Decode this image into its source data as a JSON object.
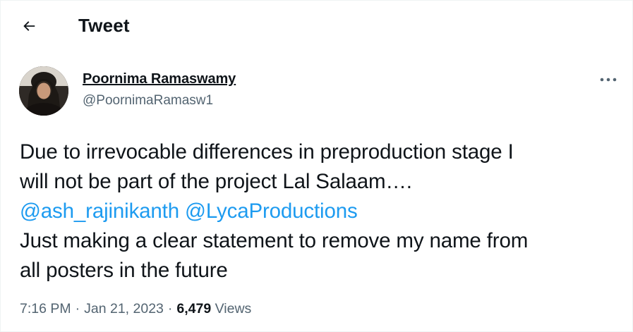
{
  "header": {
    "title": "Tweet",
    "back_icon": "arrow-left-icon"
  },
  "author": {
    "display_name": "Poornima Ramaswamy",
    "handle": "@PoornimaRamasw1",
    "more_icon": "more-horizontal-icon"
  },
  "tweet": {
    "line1": "Due to irrevocable differences in preproduction stage I",
    "line2": "will not be part of the project Lal Salaam….",
    "mention1": "@ash_rajinikanth",
    "mention2": "@LycaProductions",
    "line4": "Just making a clear statement to remove my name from",
    "line5": "all posters in the future"
  },
  "meta": {
    "time": "7:16 PM",
    "separator": "·",
    "date": "Jan 21, 2023",
    "views_count": "6,479",
    "views_label": "Views"
  },
  "colors": {
    "text": "#0f1419",
    "secondary": "#536471",
    "link": "#1d9bf0",
    "background": "#ffffff"
  }
}
